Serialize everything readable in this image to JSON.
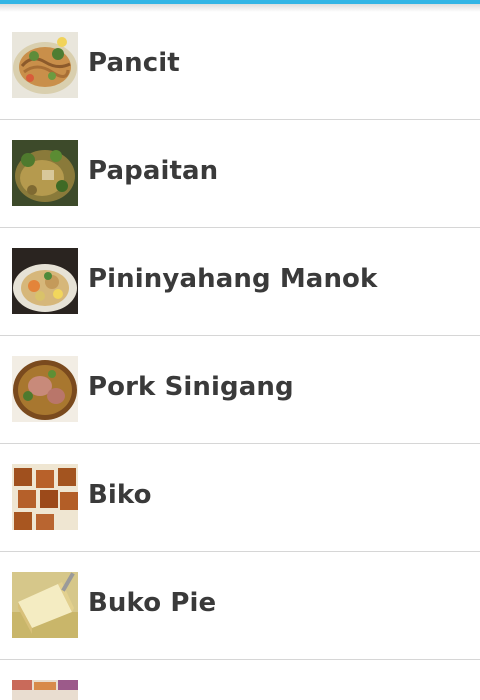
{
  "app": {
    "accent_color": "#33b5e5"
  },
  "recipes": [
    {
      "name": "Pancit",
      "icon": "pancit-thumbnail"
    },
    {
      "name": "Papaitan",
      "icon": "papaitan-thumbnail"
    },
    {
      "name": "Pininyahang Manok",
      "icon": "pininyahang-manok-thumbnail"
    },
    {
      "name": "Pork Sinigang",
      "icon": "pork-sinigang-thumbnail"
    },
    {
      "name": "Biko",
      "icon": "biko-thumbnail"
    },
    {
      "name": "Buko Pie",
      "icon": "buko-pie-thumbnail"
    }
  ]
}
